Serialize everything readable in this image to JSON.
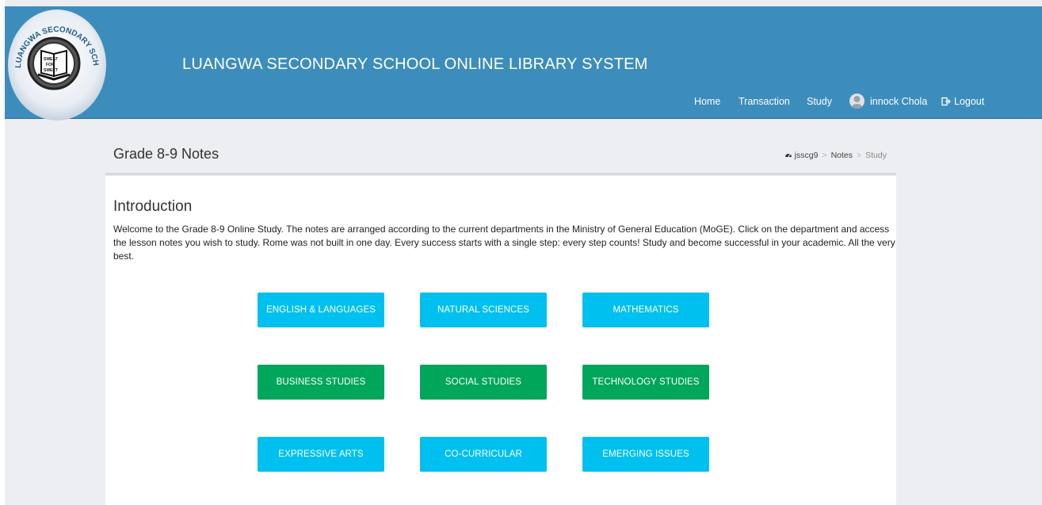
{
  "header": {
    "title": "LUANGWA SECONDARY SCHOOL ONLINE LIBRARY SYSTEM",
    "logo_text": "LUANGWA SECONDARY SCHOOL",
    "logo_inner_text": [
      "SWEAT",
      "FOR",
      "SWEET"
    ],
    "nav": {
      "home": "Home",
      "transaction": "Transaction",
      "study": "Study",
      "user": "innock Chola",
      "logout": "Logout"
    }
  },
  "page": {
    "title": "Grade 8-9 Notes",
    "breadcrumb": [
      "jsscg9",
      "Notes",
      "Study"
    ]
  },
  "intro": {
    "heading": "Introduction",
    "text": "Welcome to the Grade 8-9 Online Study. The notes are arranged according to the current departments in the Ministry of General Education (MoGE). Click on the department and access the lesson notes you wish to study. Rome was not built in one day. Every success starts with a single step: every step counts! Study and become successful in your academic. All the very best."
  },
  "departments": [
    {
      "label": "ENGLISH & LANGUAGES",
      "color": "#00c0ef"
    },
    {
      "label": "NATURAL SCIENCES",
      "color": "#00c0ef"
    },
    {
      "label": "MATHEMATICS",
      "color": "#00c0ef"
    },
    {
      "label": "BUSINESS STUDIES",
      "color": "#00a65a"
    },
    {
      "label": "SOCIAL STUDIES",
      "color": "#00a65a"
    },
    {
      "label": "TECHNOLOGY STUDIES",
      "color": "#00a65a"
    },
    {
      "label": "EXPRESSIVE ARTS",
      "color": "#00c0ef"
    },
    {
      "label": "CO-CURRICULAR",
      "color": "#00c0ef"
    },
    {
      "label": "EMERGING ISSUES",
      "color": "#00c0ef"
    }
  ],
  "colors": {
    "header": "#3c8dbc",
    "info": "#00c0ef",
    "success": "#00a65a",
    "background": "#eceef2"
  }
}
